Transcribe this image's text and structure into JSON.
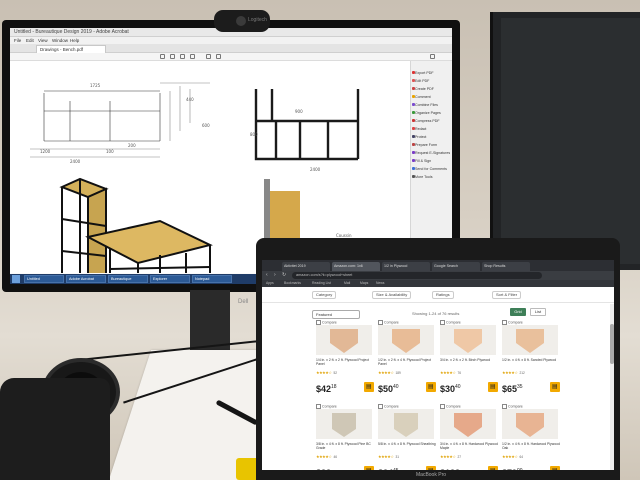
{
  "scene": {
    "description_colors": {
      "desk": "#d7cfc3",
      "wall": "#c9c0b3",
      "amazon_cart": "#f2a900",
      "grid_view_green": "#3e7f58"
    }
  },
  "monitor": {
    "webcam_brand": "Logitech",
    "brand": "Dell",
    "app": {
      "title": "Untitled - Bureautique Design 2019 - Adobe Acrobat",
      "menu": [
        "File",
        "Edit",
        "View",
        "Window",
        "Help"
      ],
      "tab_label": "Drawings - Bench.pdf",
      "right_panel_items": [
        "Export PDF",
        "Edit PDF",
        "Create PDF",
        "Comment",
        "Combine Files",
        "Organize Pages",
        "Compress PDF",
        "Redact",
        "Protect",
        "Prepare Form",
        "Request E-Signatures",
        "Fill & Sign",
        "Send for Comments",
        "More Tools"
      ]
    },
    "taskbar": {
      "items": [
        "Untitled",
        "Adobe Acrobat",
        "Bureautique",
        "Explorer",
        "Notepad"
      ],
      "time": "10:42"
    }
  },
  "laptop": {
    "brand": "MacBook Pro",
    "browser": {
      "tabs": [
        "Aktivitet 2019",
        "Amazon.com: 1x6",
        "1/2 in Plywood",
        "Google Search",
        "Shop Results"
      ],
      "url": "amazon.com/s?k=plywood+sheet",
      "bookmarks": [
        "Apps",
        "Bookmarks",
        "Reading List",
        "Mail",
        "Maps",
        "News"
      ]
    },
    "filters": [
      "Category",
      "Size & Availability",
      "Ratings",
      "Sort & Filter"
    ],
    "sort_label": "Featured",
    "results_count": "Showing 1-24 of 76 results",
    "view_grid": "Grid",
    "view_list": "List",
    "compare_label": "Compare",
    "products": [
      {
        "title": "1/4 in. x 2 ft. x 2 ft. Plywood Project Panel",
        "price_main": "42",
        "price_cents": "18",
        "reviews": "52",
        "rating": 4,
        "thumb_color": "#e2b896"
      },
      {
        "title": "1/2 in. x 2 ft. x 4 ft. Plywood Project Panel",
        "price_main": "50",
        "price_cents": "40",
        "reviews": "189",
        "rating": 4,
        "thumb_color": "#e8bc97"
      },
      {
        "title": "3/4 in. x 2 ft. x 2 ft. Birch Plywood",
        "price_main": "30",
        "price_cents": "40",
        "reviews": "76",
        "rating": 4,
        "thumb_color": "#efc8a6"
      },
      {
        "title": "1/2 in. x 4 ft. x 8 ft. Sanded Plywood",
        "price_main": "65",
        "price_cents": "35",
        "reviews": "212",
        "rating": 4,
        "thumb_color": "#e9c09c"
      },
      {
        "title": "3/8 in. x 4 ft. x 8 ft. Plywood Pine BC Grade",
        "price_main": "33",
        "price_cents": "",
        "reviews": "46",
        "rating": 4,
        "thumb_color": "#cfc7b6"
      },
      {
        "title": "5/8 in. x 4 ft. x 8 ft. Plywood Sheathing",
        "price_main": "24",
        "price_cents": "45",
        "reviews": "31",
        "rating": 4,
        "thumb_color": "#d9d0bc"
      },
      {
        "title": "3/4 in. x 4 ft. x 8 ft. Hardwood Plywood Maple",
        "price_main": "133",
        "price_cents": "",
        "reviews": "27",
        "rating": 4,
        "thumb_color": "#e6a98a"
      },
      {
        "title": "1/2 in. x 4 ft. x 8 ft. Hardwood Plywood Oak",
        "price_main": "79",
        "price_cents": "00",
        "reviews": "64",
        "rating": 4,
        "thumb_color": "#e8b493"
      }
    ]
  }
}
